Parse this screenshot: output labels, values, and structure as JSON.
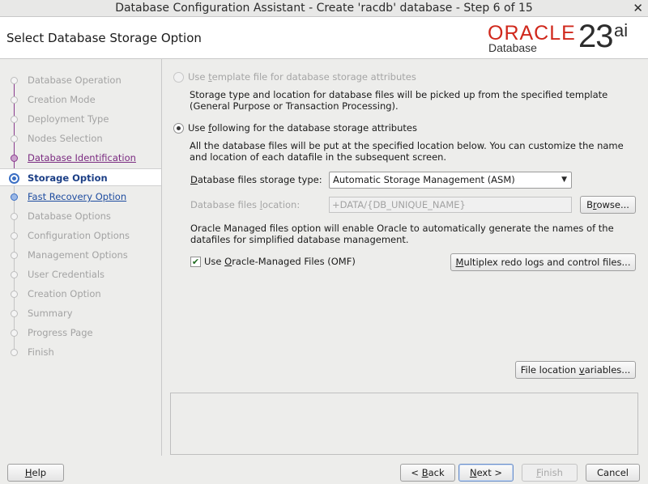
{
  "window": {
    "title": "Database Configuration Assistant - Create 'racdb' database - Step 6 of 15",
    "close_glyph": "✕"
  },
  "header": {
    "page_title": "Select Database Storage Option",
    "logo": {
      "brand": "ORACLE",
      "product": "Database",
      "version": "23",
      "version_suffix": "ai",
      "brand_color": "#d0281c"
    }
  },
  "nav": {
    "items": [
      {
        "label": "Database Operation",
        "state": "disabled"
      },
      {
        "label": "Creation Mode",
        "state": "disabled"
      },
      {
        "label": "Deployment Type",
        "state": "disabled"
      },
      {
        "label": "Nodes Selection",
        "state": "disabled"
      },
      {
        "label": "Database Identification",
        "state": "visited"
      },
      {
        "label": "Storage Option",
        "state": "active"
      },
      {
        "label": "Fast Recovery Option",
        "state": "link"
      },
      {
        "label": "Database Options",
        "state": "disabled"
      },
      {
        "label": "Configuration Options",
        "state": "disabled"
      },
      {
        "label": "Management Options",
        "state": "disabled"
      },
      {
        "label": "User Credentials",
        "state": "disabled"
      },
      {
        "label": "Creation Option",
        "state": "disabled"
      },
      {
        "label": "Summary",
        "state": "disabled"
      },
      {
        "label": "Progress Page",
        "state": "disabled"
      },
      {
        "label": "Finish",
        "state": "disabled"
      }
    ]
  },
  "main": {
    "template_option": {
      "pre": "Use ",
      "mnemonic": "t",
      "post": "emplate file for database storage attributes",
      "description_line1": "Storage type and location for database files will be picked up from the specified template",
      "description_line2": "(General Purpose or Transaction Processing)."
    },
    "following_option": {
      "pre": "Use ",
      "mnemonic": "f",
      "post": "ollowing for the database storage attributes",
      "description_line1": "All the database files will be put at the specified location below. You can customize the name",
      "description_line2": "and location of each datafile in the subsequent screen."
    },
    "storage_type": {
      "label_mnemonic": "D",
      "label_rest": "atabase files storage type:",
      "value": "Automatic Storage Management (ASM)",
      "arrow": "▼"
    },
    "files_location": {
      "label_pre": "Database files ",
      "label_mnemonic": "l",
      "label_post": "ocation:",
      "value": "+DATA/{DB_UNIQUE_NAME}",
      "browse_pre": "B",
      "browse_mnemonic": "r",
      "browse_post": "owse..."
    },
    "omf_note_line1": "Oracle Managed files option will enable Oracle to automatically generate the names of the",
    "omf_note_line2": "datafiles for simplified database management.",
    "omf_checkbox": {
      "pre": "Use ",
      "mnemonic": "O",
      "post": "racle-Managed Files (OMF)",
      "checked": true,
      "check_glyph": "✔"
    },
    "multiplex_button": {
      "mnemonic": "M",
      "rest": "ultiplex redo logs and control files..."
    },
    "file_location_button": {
      "pre": "File location ",
      "mnemonic": "v",
      "post": "ariables..."
    }
  },
  "footer": {
    "help": {
      "mnemonic": "H",
      "rest": "elp"
    },
    "back": {
      "pre": "< ",
      "mnemonic": "B",
      "post": "ack"
    },
    "next": {
      "mnemonic": "N",
      "post": "ext >"
    },
    "finish": {
      "mnemonic": "F",
      "post": "inish"
    },
    "cancel": "Cancel"
  }
}
